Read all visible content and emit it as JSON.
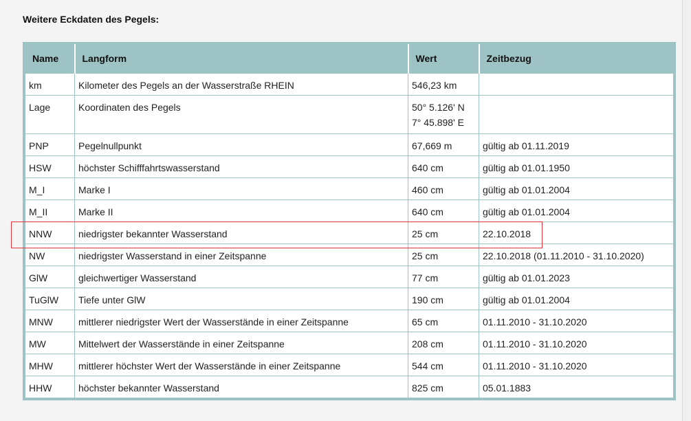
{
  "section": {
    "title": "Weitere Eckdaten des Pegels:"
  },
  "table": {
    "headers": [
      "Name",
      "Langform",
      "Wert",
      "Zeitbezug"
    ],
    "rows": [
      {
        "name": "km",
        "langform": "Kilometer des Pegels an der Wasserstraße RHEIN",
        "wert": "546,23 km",
        "zeitbezug": ""
      },
      {
        "name": "Lage",
        "langform": "Koordinaten des Pegels",
        "wert": "50° 5.126' N",
        "wert2": "7° 45.898' E",
        "zeitbezug": ""
      },
      {
        "name": "PNP",
        "langform": "Pegelnullpunkt",
        "wert": "67,669 m",
        "zeitbezug": "gültig ab 01.11.2019"
      },
      {
        "name": "HSW",
        "langform": "höchster Schifffahrtswasserstand",
        "wert": "640 cm",
        "zeitbezug": "gültig ab 01.01.1950"
      },
      {
        "name": "M_I",
        "langform": "Marke I",
        "wert": "460 cm",
        "zeitbezug": "gültig ab 01.01.2004"
      },
      {
        "name": "M_II",
        "langform": "Marke II",
        "wert": "640 cm",
        "zeitbezug": "gültig ab 01.01.2004"
      },
      {
        "name": "NNW",
        "langform": "niedrigster bekannter Wasserstand",
        "wert": "25 cm",
        "zeitbezug": "22.10.2018"
      },
      {
        "name": "NW",
        "langform": "niedrigster Wasserstand in einer Zeitspanne",
        "wert": "25 cm",
        "zeitbezug": "22.10.2018 (01.11.2010 - 31.10.2020)"
      },
      {
        "name": "GlW",
        "langform": "gleichwertiger Wasserstand",
        "wert": "77 cm",
        "zeitbezug": "gültig ab 01.01.2023"
      },
      {
        "name": "TuGlW",
        "langform": "Tiefe unter GlW",
        "wert": "190 cm",
        "zeitbezug": "gültig ab 01.01.2004"
      },
      {
        "name": "MNW",
        "langform": "mittlerer niedrigster Wert der Wasserstände in einer Zeitspanne",
        "wert": "65 cm",
        "zeitbezug": "01.11.2010 - 31.10.2020"
      },
      {
        "name": "MW",
        "langform": "Mittelwert der Wasserstände in einer Zeitspanne",
        "wert": "208 cm",
        "zeitbezug": "01.11.2010 - 31.10.2020"
      },
      {
        "name": "MHW",
        "langform": "mittlerer höchster Wert der Wasserstände in einer Zeitspanne",
        "wert": "544 cm",
        "zeitbezug": "01.11.2010 - 31.10.2020"
      },
      {
        "name": "HHW",
        "langform": "höchster bekannter Wasserstand",
        "wert": "825 cm",
        "zeitbezug": "05.01.1883"
      }
    ]
  },
  "colors": {
    "table_accent": "#9dc3c4",
    "highlight_border": "#e0333a",
    "page_background": "#f4f4f4"
  }
}
